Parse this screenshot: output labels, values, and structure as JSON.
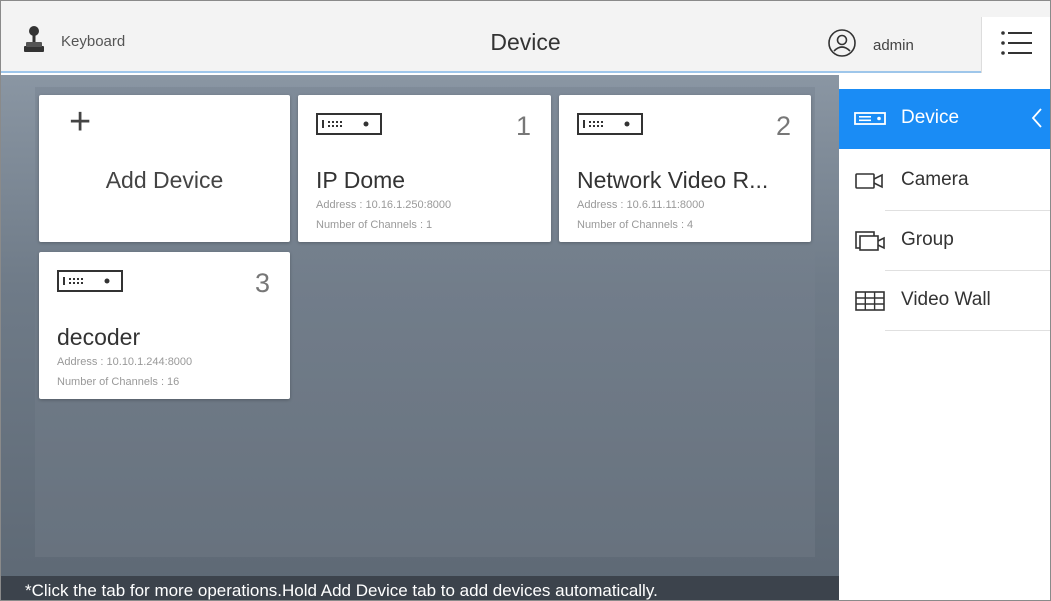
{
  "header": {
    "keyboard_label": "Keyboard",
    "title": "Device",
    "user_label": "admin"
  },
  "add_device": {
    "plus": "+",
    "label": "Add Device"
  },
  "devices": [
    {
      "number": "1",
      "name": "IP Dome",
      "address": "Address : 10.16.1.250:8000",
      "channels": "Number of Channels : 1"
    },
    {
      "number": "2",
      "name": "Network Video R...",
      "address": "Address : 10.6.11.11:8000",
      "channels": "Number of Channels : 4"
    },
    {
      "number": "3",
      "name": "decoder",
      "address": "Address : 10.10.1.244:8000",
      "channels": "Number of Channels : 16"
    }
  ],
  "sidebar": {
    "items": [
      {
        "label": "Device",
        "icon": "device-icon",
        "active": true
      },
      {
        "label": "Camera",
        "icon": "camera-icon",
        "active": false
      },
      {
        "label": "Group",
        "icon": "group-icon",
        "active": false
      },
      {
        "label": "Video Wall",
        "icon": "video-wall-icon",
        "active": false
      }
    ]
  },
  "hint": "*Click the tab for more operations.Hold Add Device tab to add devices automatically.",
  "colors": {
    "accent": "#1a8cf5",
    "header_bg": "#f3f3f3",
    "hint_bar": "#3c434c"
  }
}
